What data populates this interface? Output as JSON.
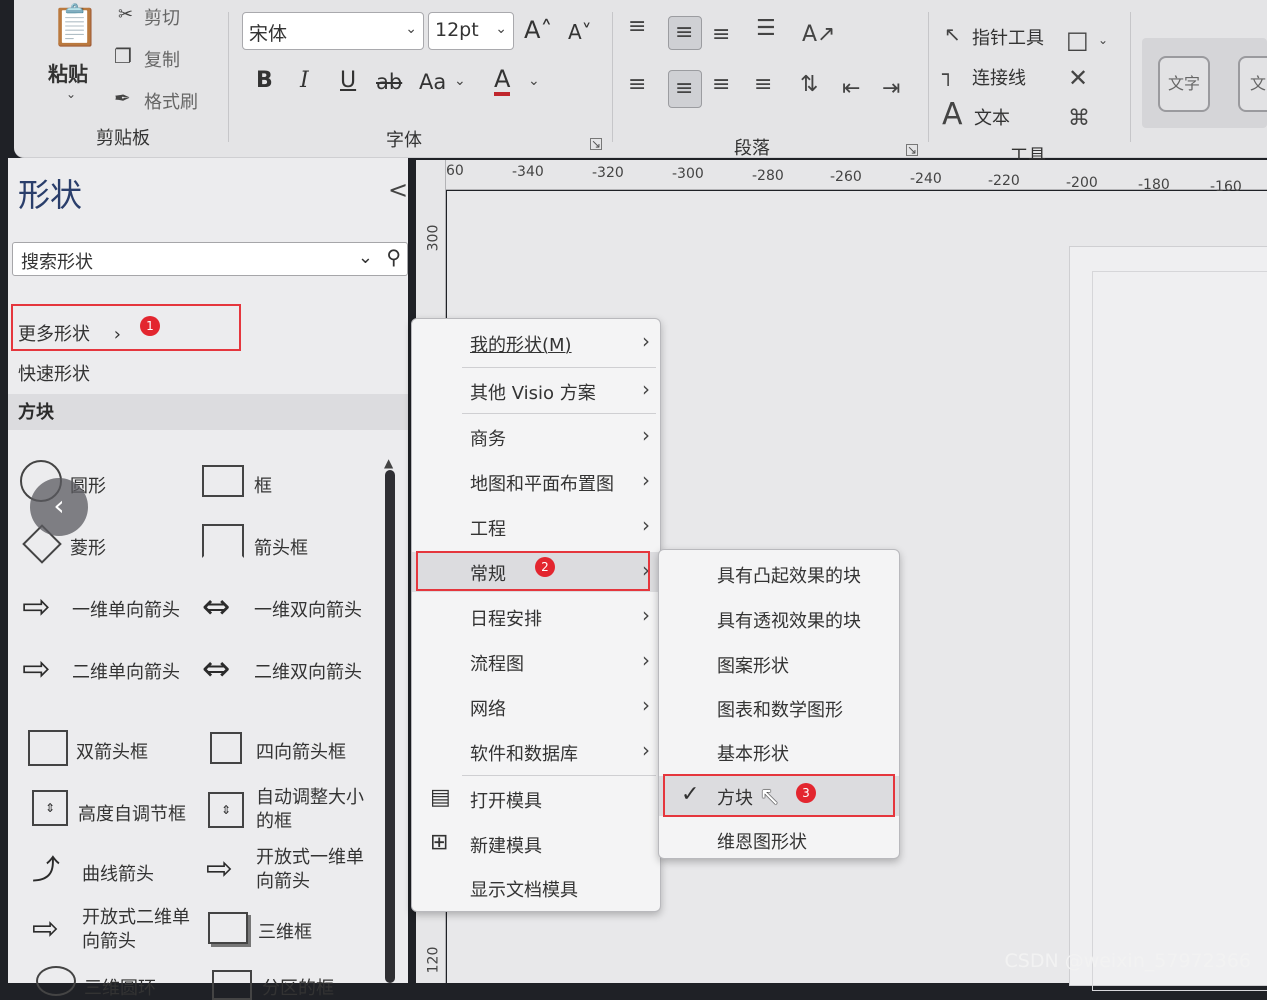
{
  "ribbon": {
    "clipboard": {
      "paste": "粘贴",
      "cut": "剪切",
      "copy": "复制",
      "format_painter": "格式刷",
      "group": "剪贴板"
    },
    "font": {
      "name": "宋体",
      "size": "12pt",
      "grow": "A˄",
      "shrink": "A˅",
      "bold": "B",
      "italic": "I",
      "underline": "U",
      "strike": "ab",
      "case": "Aa",
      "color": "A",
      "group": "字体"
    },
    "paragraph": {
      "group": "段落"
    },
    "tools": {
      "pointer": "指针工具",
      "connector": "连接线",
      "text": "文本",
      "group": "工具"
    },
    "style": {
      "label": "文字",
      "label2": "文"
    }
  },
  "pane": {
    "title": "形状",
    "collapse": "<",
    "search_placeholder": "搜索形状",
    "more_shapes": "更多形状",
    "quick_shapes": "快速形状",
    "blocks": "方块",
    "shapes": [
      {
        "label": "圆形"
      },
      {
        "label": "框"
      },
      {
        "label": "菱形"
      },
      {
        "label": "箭头框"
      },
      {
        "label": "一维单向箭头"
      },
      {
        "label": "一维双向箭头"
      },
      {
        "label": "二维单向箭头"
      },
      {
        "label": "二维双向箭头"
      },
      {
        "label": "双箭头框"
      },
      {
        "label": "四向箭头框"
      },
      {
        "label": "高度自调节框"
      },
      {
        "label": "自动调整大小的框"
      },
      {
        "label": "曲线箭头"
      },
      {
        "label": "开放式一维单向箭头"
      },
      {
        "label": "开放式二维单向箭头"
      },
      {
        "label": "三维框"
      },
      {
        "label": "三维圆环"
      },
      {
        "label": "分区的框"
      }
    ]
  },
  "ruler": {
    "h_ticks": [
      "60",
      "-340",
      "-320",
      "-300",
      "-280",
      "-260",
      "-240",
      "-220",
      "-200",
      "-180",
      "-160"
    ],
    "v_ticks": [
      "300",
      "120"
    ]
  },
  "menu1": {
    "items": [
      {
        "label": "我的形状(M)",
        "arrow": true
      },
      {
        "label": "其他 Visio 方案",
        "arrow": true
      },
      {
        "label": "商务",
        "arrow": true
      },
      {
        "label": "地图和平面布置图",
        "arrow": true
      },
      {
        "label": "工程",
        "arrow": true
      },
      {
        "label": "常规",
        "arrow": true
      },
      {
        "label": "日程安排",
        "arrow": true
      },
      {
        "label": "流程图",
        "arrow": true
      },
      {
        "label": "网络",
        "arrow": true
      },
      {
        "label": "软件和数据库",
        "arrow": true
      },
      {
        "label": "打开模具",
        "arrow": false
      },
      {
        "label": "新建模具",
        "arrow": false
      },
      {
        "label": "显示文档模具",
        "arrow": false
      }
    ]
  },
  "menu2": {
    "items": [
      {
        "label": "具有凸起效果的块"
      },
      {
        "label": "具有透视效果的块"
      },
      {
        "label": "图案形状"
      },
      {
        "label": "图表和数学图形"
      },
      {
        "label": "基本形状"
      },
      {
        "label": "方块",
        "checked": true
      },
      {
        "label": "维恩图形状"
      }
    ]
  },
  "badges": [
    "1",
    "2",
    "3"
  ],
  "watermark": "CSDN @weixin_57972366",
  "colors": {
    "annotation_red": "#e5363d",
    "badge_red": "#e3262f",
    "title_blue": "#2a3e6b"
  }
}
